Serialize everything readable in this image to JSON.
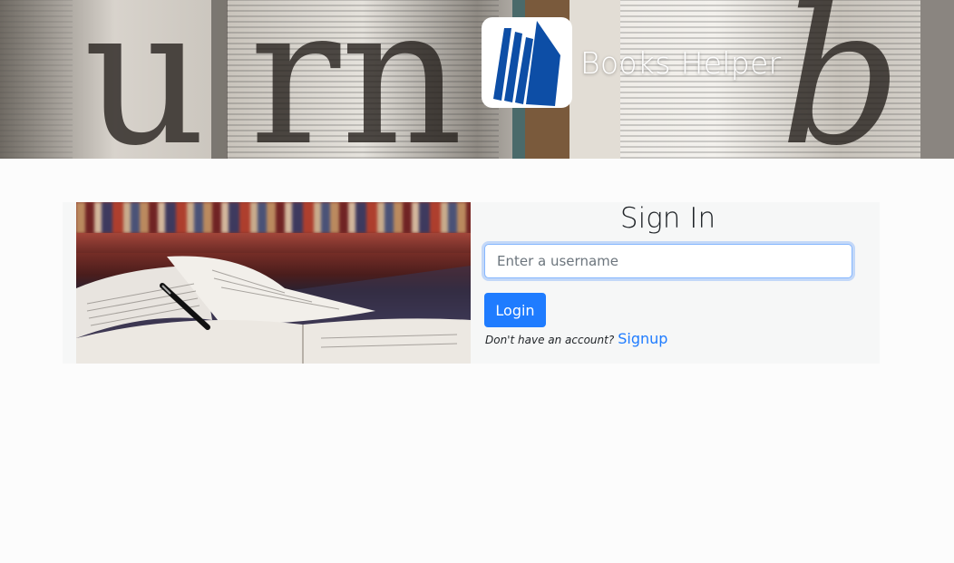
{
  "header": {
    "brand_title": "Books Helper",
    "logo_icon": "books-logo-icon"
  },
  "signin": {
    "title": "Sign In",
    "username_placeholder": "Enter a username",
    "username_value": "",
    "login_label": "Login",
    "no_account_text": "Don't have an account?",
    "signup_label": "Signup"
  },
  "colors": {
    "accent": "#1f7cff",
    "logo_blue": "#0d4ea6",
    "card_bg": "#f6f7f7"
  }
}
